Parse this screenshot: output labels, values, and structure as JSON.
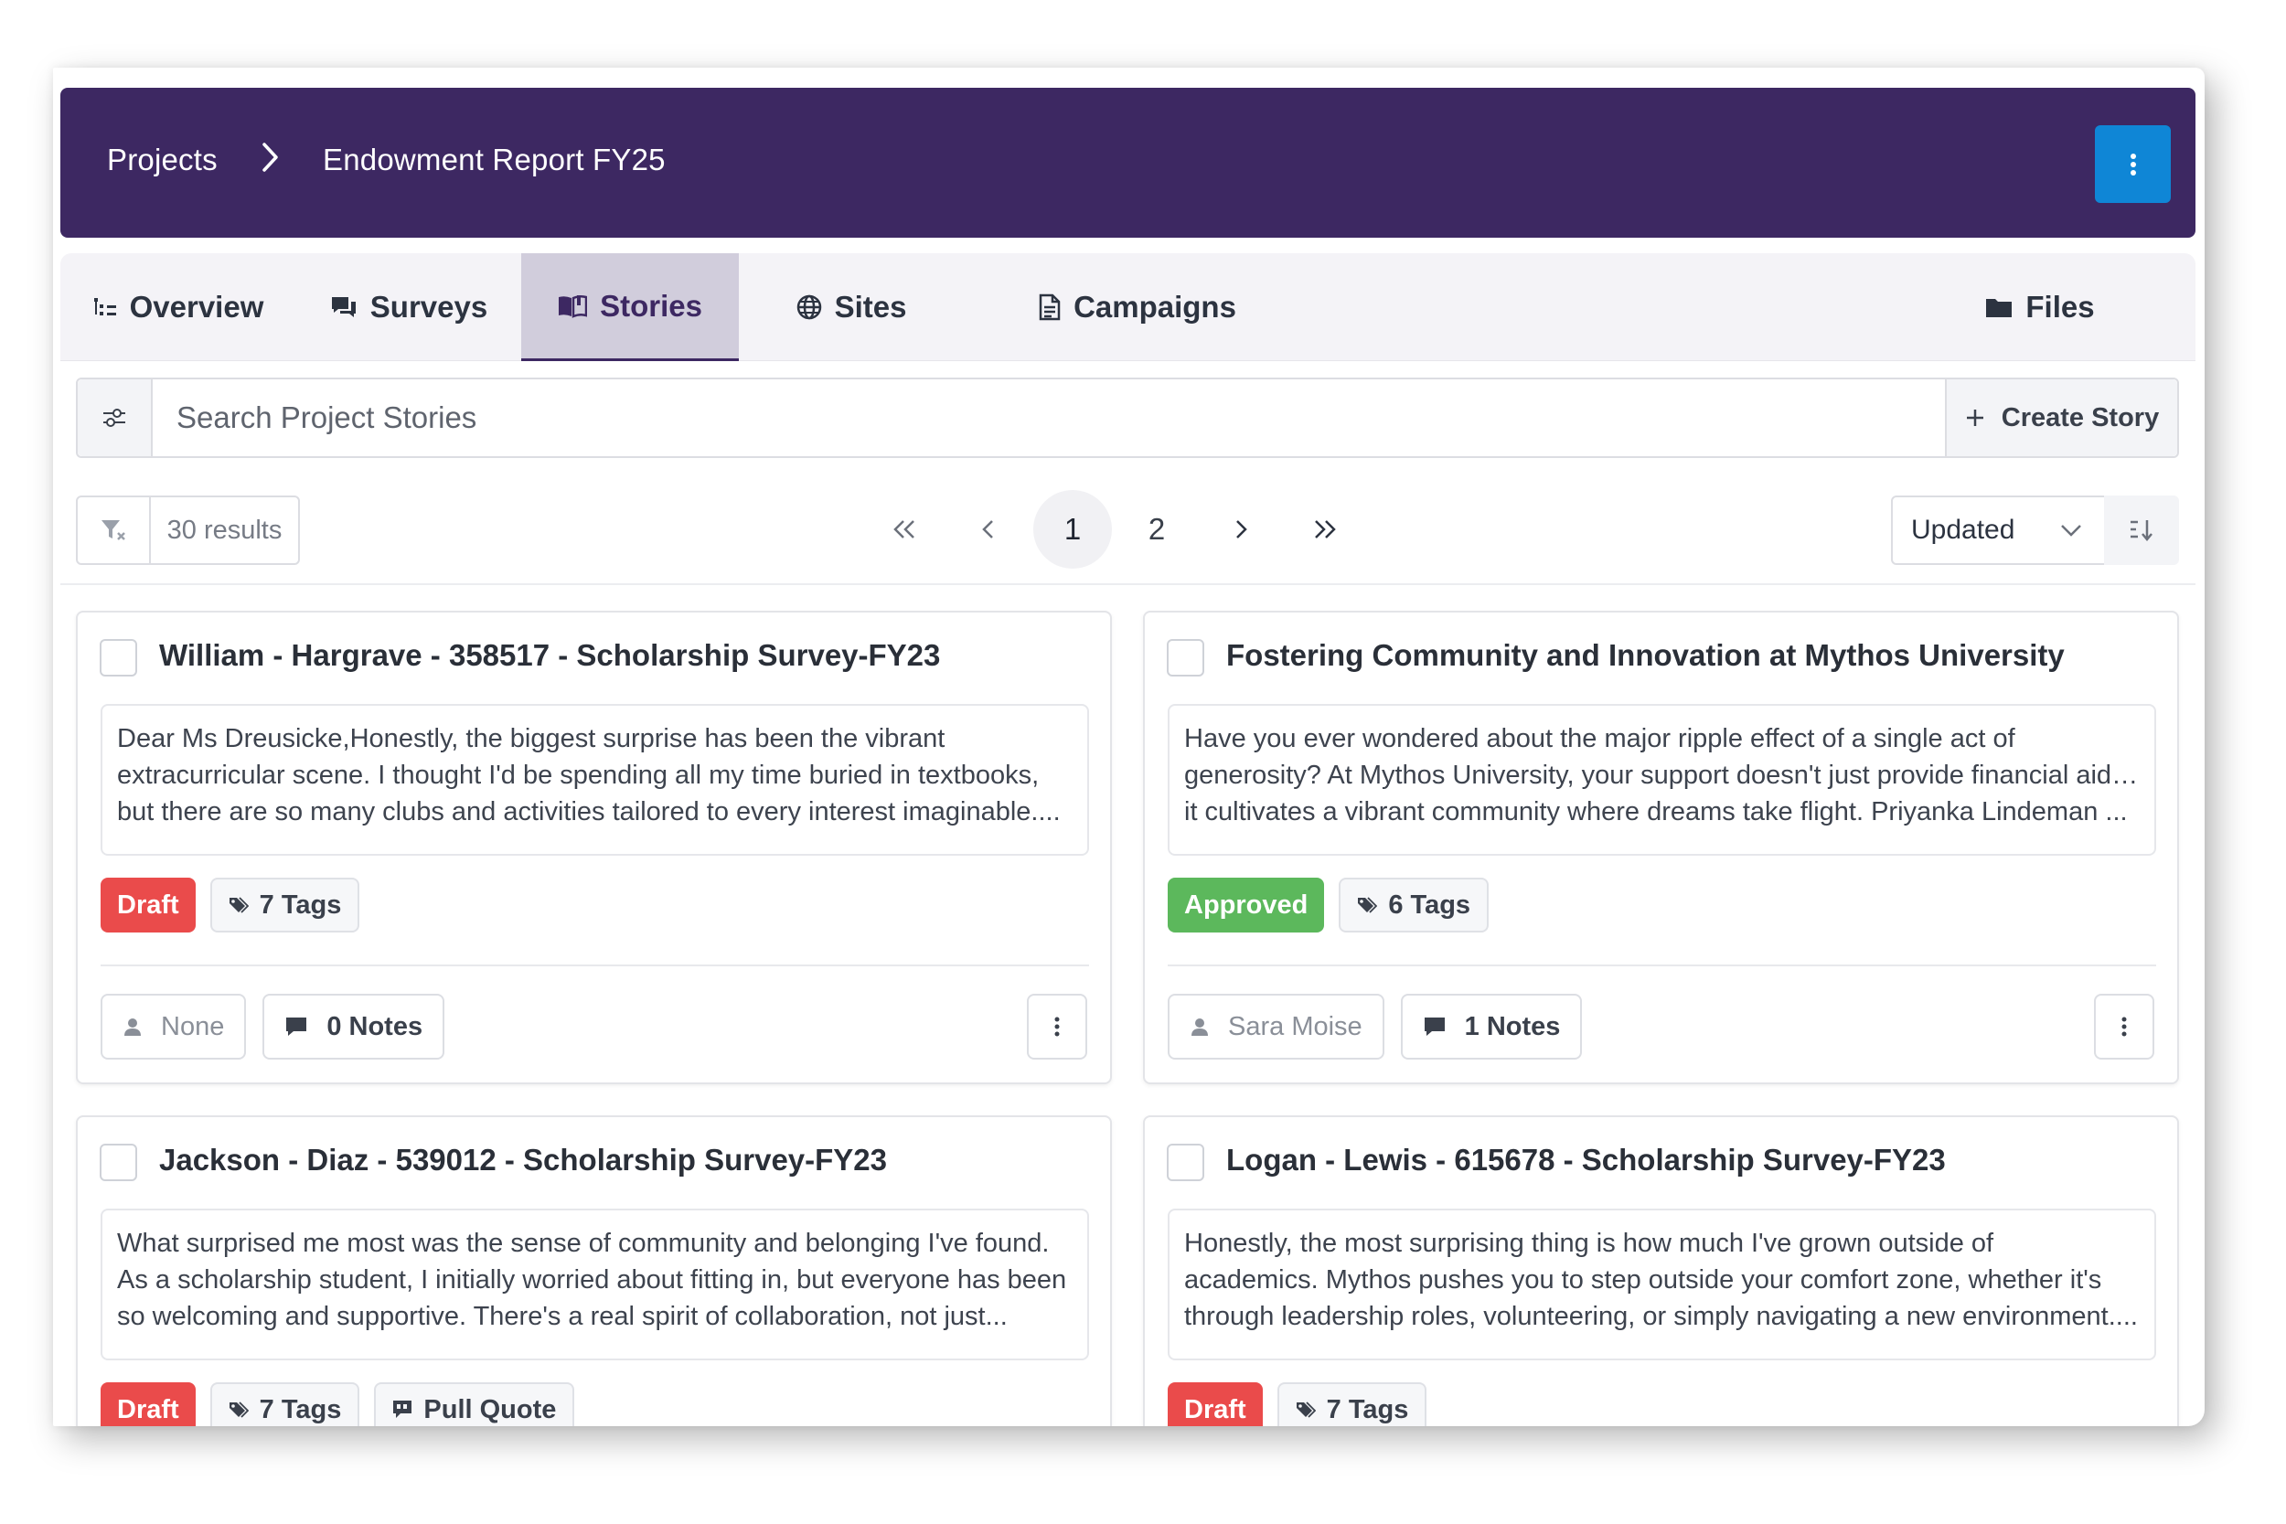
{
  "breadcrumb": {
    "root": "Projects",
    "current": "Endowment Report FY25"
  },
  "tabs": [
    {
      "label": "Overview",
      "icon": "outline-list-icon"
    },
    {
      "label": "Surveys",
      "icon": "comments-icon"
    },
    {
      "label": "Stories",
      "icon": "book-open-icon",
      "active": true
    },
    {
      "label": "Sites",
      "icon": "globe-icon"
    },
    {
      "label": "Campaigns",
      "icon": "document-icon"
    },
    {
      "label": "Files",
      "icon": "folder-icon"
    }
  ],
  "search": {
    "placeholder": "Search Project Stories",
    "value": ""
  },
  "create_label": "Create Story",
  "results": "30 results",
  "pagination": {
    "pages": [
      "1",
      "2"
    ],
    "current": "1"
  },
  "sort": {
    "selected": "Updated"
  },
  "colors": {
    "header": "#3d2862",
    "accent": "#0f86d6",
    "draft": "#ea4b4b",
    "approved": "#5cb85c"
  },
  "stories": [
    {
      "title": "William - Hargrave - 358517 - Scholarship Survey-FY23",
      "excerpt": [
        "Dear Ms Dreusicke,Honestly, the biggest surprise has been the vibrant",
        "extracurricular scene. I thought I'd be spending all my time buried in textbooks,",
        "but there are so many clubs and activities tailored to every interest imaginable...."
      ],
      "status": "Draft",
      "tags": "7 Tags",
      "assignee": "None",
      "notes": "0 Notes"
    },
    {
      "title": "Fostering Community and Innovation at Mythos University",
      "excerpt": [
        "Have you ever wondered about the major ripple effect of a single act of",
        "generosity? At Mythos University, your support doesn't just provide financial aid —",
        "it cultivates a vibrant community where dreams take flight. Priyanka Lindeman ..."
      ],
      "status": "Approved",
      "tags": "6 Tags",
      "assignee": "Sara Moise",
      "notes": "1 Notes"
    },
    {
      "title": "Jackson - Diaz - 539012 - Scholarship Survey-FY23",
      "excerpt": [
        "What surprised me most was the sense of community and belonging I've found.",
        "As a scholarship student, I initially worried about fitting in, but everyone has been",
        "so welcoming and supportive. There's a real spirit of collaboration, not just..."
      ],
      "status": "Draft",
      "tags": "7 Tags",
      "extra_chip": "Pull Quote"
    },
    {
      "title": "Logan - Lewis - 615678 - Scholarship Survey-FY23",
      "excerpt": [
        "Honestly, the most surprising thing is how much I've grown outside of",
        "academics. Mythos pushes you to step outside your comfort zone, whether it's",
        "through leadership roles, volunteering, or simply navigating a new environment...."
      ],
      "status": "Draft",
      "tags": "7 Tags"
    }
  ]
}
